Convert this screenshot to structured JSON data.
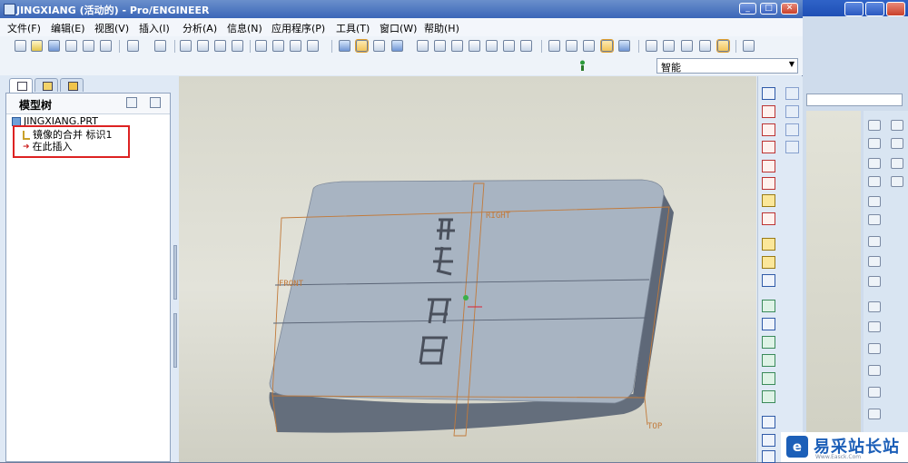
{
  "window": {
    "title": "JINGXIANG (活动的) - Pro/ENGINEER"
  },
  "menu": {
    "items": [
      {
        "label": "文件(F)"
      },
      {
        "label": "编辑(E)"
      },
      {
        "label": "视图(V)"
      },
      {
        "label": "插入(I)"
      },
      {
        "label": "分析(A)"
      },
      {
        "label": "信息(N)"
      },
      {
        "label": "应用程序(P)"
      },
      {
        "label": "工具(T)"
      },
      {
        "label": "窗口(W)"
      },
      {
        "label": "帮助(H)"
      }
    ]
  },
  "filter": {
    "value": "智能"
  },
  "model_tree": {
    "title": "模型树",
    "items": [
      {
        "label": "JINGXIANG.PRT",
        "icon": "part-icon"
      },
      {
        "label": "镜像的合并 标识1",
        "icon": "mirror-merge-icon"
      },
      {
        "label": "在此插入",
        "icon": "insert-here-arrow-icon"
      }
    ]
  },
  "viewport": {
    "datum_labels": {
      "right": "RIGHT",
      "front": "FRONT",
      "top": "TOP"
    },
    "part_color": "#a8b4c2",
    "datum_color": "#c27a3a"
  },
  "watermark": {
    "text": "易采站长站",
    "sub": "Www.Easck.Com"
  }
}
